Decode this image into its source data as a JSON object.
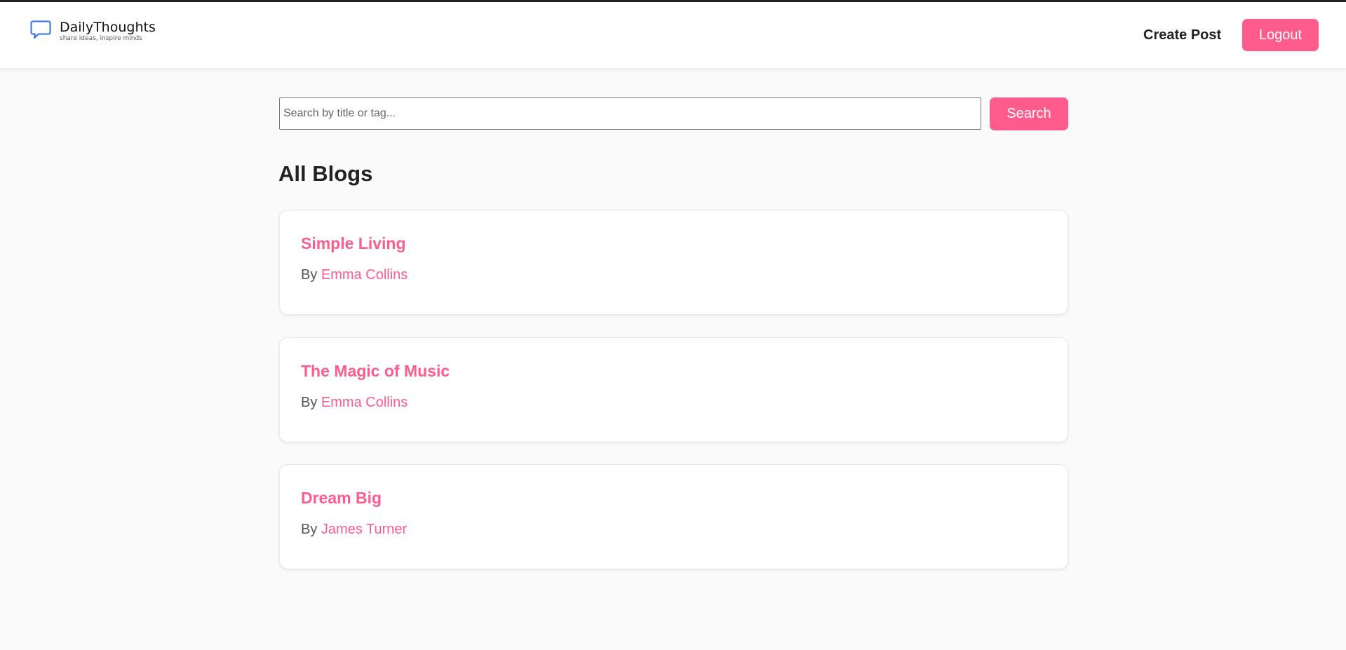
{
  "colors": {
    "accent": "#ff5c8d",
    "brand_icon": "#2f6fed",
    "text_dark": "#222222",
    "background": "#fafafa"
  },
  "header": {
    "brand_name": "DailyThoughts",
    "brand_tagline": "share ideas, inspire minds",
    "brand_icon": "chat-bubble-icon",
    "create_post_label": "Create Post",
    "logout_label": "Logout"
  },
  "search": {
    "placeholder": "Search by title or tag...",
    "value": "",
    "button_label": "Search"
  },
  "main": {
    "title": "All Blogs",
    "byline_prefix": "By",
    "posts": [
      {
        "title": "Simple Living",
        "author": "Emma Collins"
      },
      {
        "title": "The Magic of Music",
        "author": "Emma Collins"
      },
      {
        "title": "Dream Big",
        "author": "James Turner"
      }
    ]
  }
}
